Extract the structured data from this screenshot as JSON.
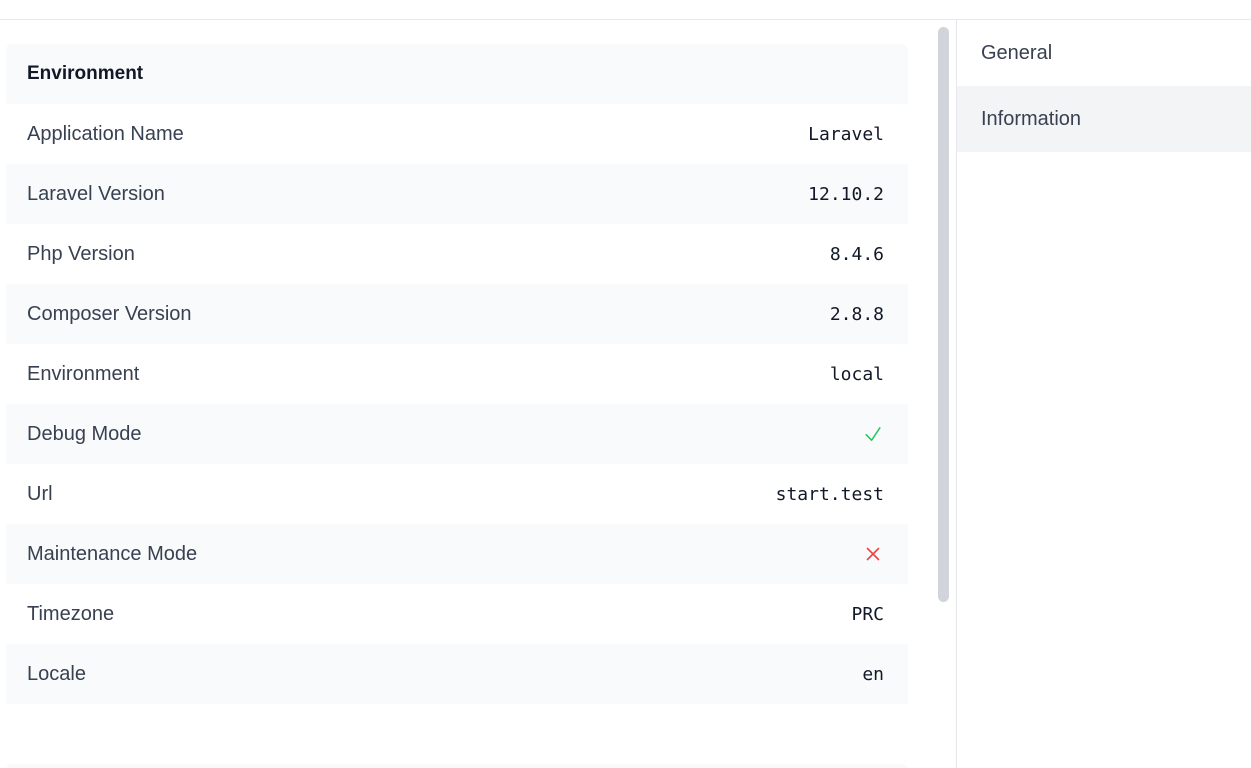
{
  "environment": {
    "title": "Environment",
    "rows": [
      {
        "label": "Application Name",
        "value": "Laravel"
      },
      {
        "label": "Laravel Version",
        "value": "12.10.2"
      },
      {
        "label": "Php Version",
        "value": "8.4.6"
      },
      {
        "label": "Composer Version",
        "value": "2.8.8"
      },
      {
        "label": "Environment",
        "value": "local"
      },
      {
        "label": "Debug Mode",
        "value": null,
        "icon": "check-icon"
      },
      {
        "label": "Url",
        "value": "start.test"
      },
      {
        "label": "Maintenance Mode",
        "value": null,
        "icon": "x-icon"
      },
      {
        "label": "Timezone",
        "value": "PRC"
      },
      {
        "label": "Locale",
        "value": "en"
      }
    ]
  },
  "sidebar": {
    "items": [
      {
        "label": "General",
        "active": false
      },
      {
        "label": "Information",
        "active": true
      }
    ]
  },
  "colors": {
    "check": "#22c55e",
    "cross": "#ef4444",
    "row_alt": "#f9fafb",
    "active_nav": "#f3f4f6"
  }
}
